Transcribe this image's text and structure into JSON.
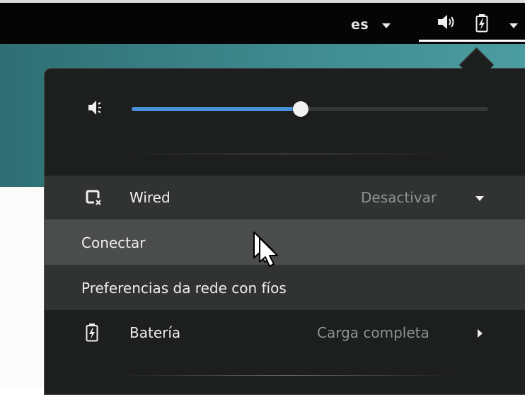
{
  "top_bar": {
    "language_indicator": "es",
    "icons": [
      "volume-icon",
      "battery-charging-icon",
      "chevron-down-icon"
    ]
  },
  "volume": {
    "icon": "volume-muted-icon",
    "level_fraction": 0.475,
    "accent_color": "#4a90d9"
  },
  "network": {
    "icon": "wired-disconnected-icon",
    "label": "Wired",
    "state_label": "Desactivar",
    "items": [
      {
        "label": "Conectar",
        "highlighted": true
      },
      {
        "label": "Preferencias da rede con fíos",
        "highlighted": false
      }
    ]
  },
  "battery": {
    "icon": "battery-charging-icon",
    "label": "Batería",
    "status": "Carga completa"
  }
}
